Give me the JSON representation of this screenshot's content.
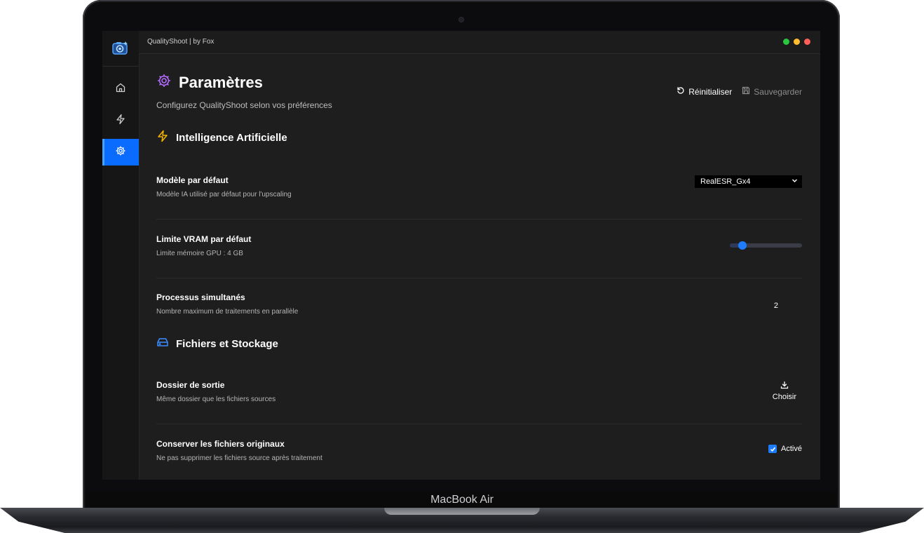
{
  "device": {
    "label": "MacBook Air"
  },
  "app": {
    "title": "QualityShoot | by Fox",
    "traffic_colors": [
      "#28c840",
      "#febc2e",
      "#ff5f57"
    ]
  },
  "sidebar": {
    "items": [
      {
        "icon": "home-icon",
        "active": false
      },
      {
        "icon": "bolt-icon",
        "active": false
      },
      {
        "icon": "gear-icon",
        "active": true
      }
    ]
  },
  "header": {
    "title": "Paramètres",
    "subtitle": "Configurez QualityShoot selon vos préférences",
    "reset_label": "Réinitialiser",
    "save_label": "Sauvegarder"
  },
  "sections": {
    "ai": {
      "title": "Intelligence Artificielle",
      "icon": "bolt-icon",
      "color": "#f5b400"
    },
    "files": {
      "title": "Fichiers et Stockage",
      "icon": "drive-icon",
      "color": "#3b8cff"
    }
  },
  "settings": {
    "model": {
      "label": "Modèle par défaut",
      "description": "Modèle IA utilisé par défaut pour l'upscaling",
      "value": "RealESR_Gx4"
    },
    "vram": {
      "label": "Limite VRAM par défaut",
      "description": "Limite mémoire GPU : 4 GB",
      "slider_fraction": 0.17
    },
    "processes": {
      "label": "Processus simultanés",
      "description": "Nombre maximum de traitements en parallèle",
      "value": "2"
    },
    "output": {
      "label": "Dossier de sortie",
      "description": "Même dossier que les fichiers sources",
      "button_label": "Choisir"
    },
    "keep_originals": {
      "label": "Conserver les fichiers originaux",
      "description": "Ne pas supprimer les fichiers source après traitement",
      "checked": true,
      "state_label": "Activé"
    }
  },
  "colors": {
    "accent": "#1e7cff",
    "title_icon": "#b36bff",
    "background": "#1e1e1e"
  }
}
